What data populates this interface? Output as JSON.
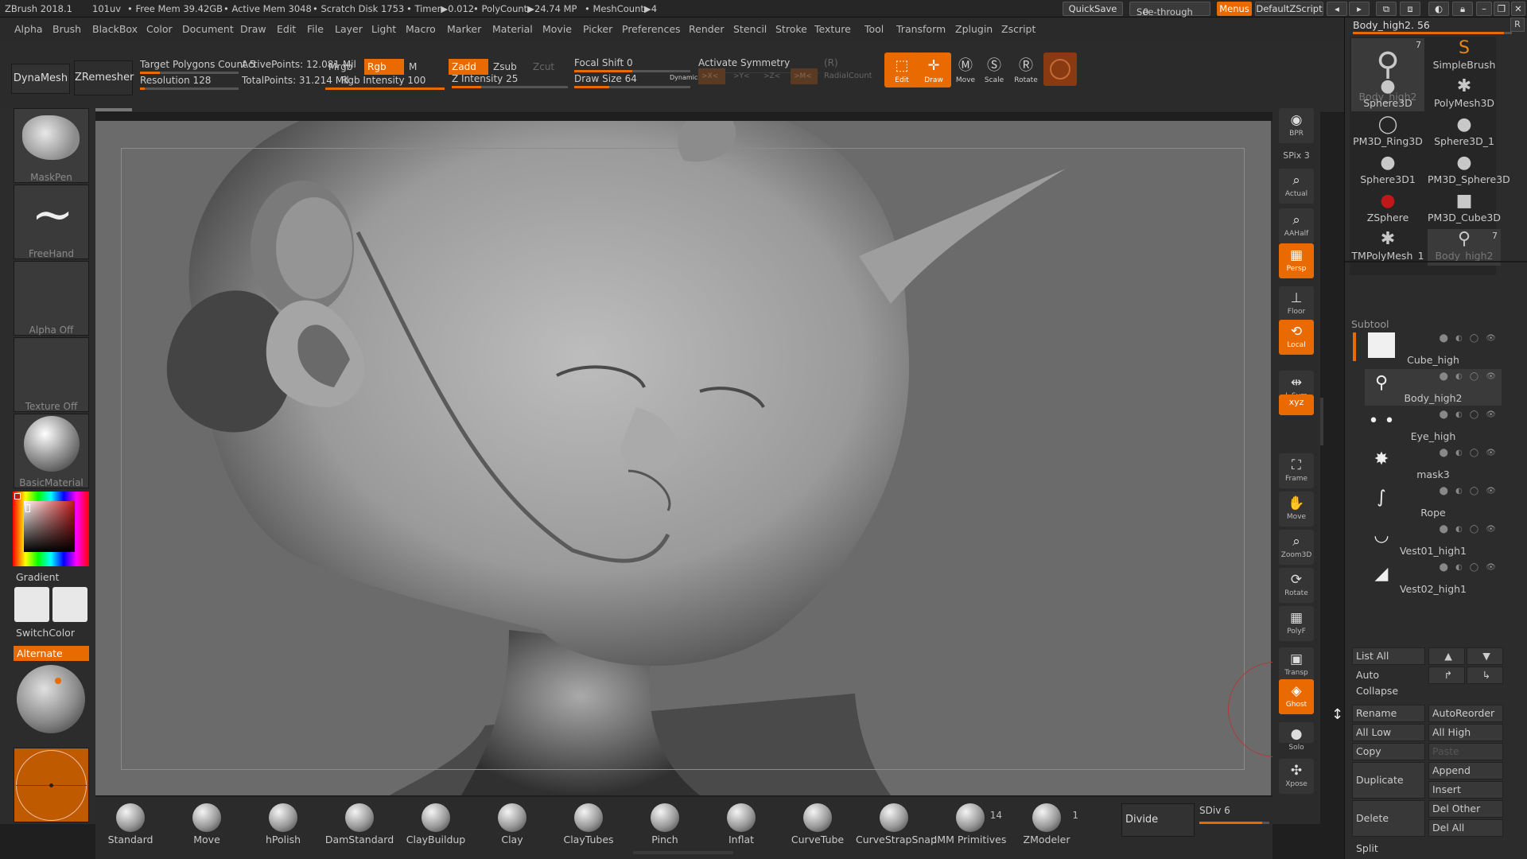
{
  "topbar": {
    "app": "ZBrush 2018.1",
    "uv": "101uv",
    "free_mem": "• Free Mem 39.42GB",
    "active_mem": "• Active Mem 3048",
    "scratch": "• Scratch Disk 1753",
    "timer": "• Timer▶0.012",
    "polycount": "• PolyCount▶24.74 MP",
    "meshcount": "• MeshCount▶4",
    "quicksave": "QuickSave",
    "seethrough": "See-through",
    "seethrough_val": "0",
    "menus": "Menus",
    "defaultzscript": "DefaultZScript"
  },
  "menu": [
    "Alpha",
    "Brush",
    "BlackBox",
    "Color",
    "Document",
    "Draw",
    "Edit",
    "File",
    "Layer",
    "Light",
    "Macro",
    "Marker",
    "Material",
    "Movie",
    "Picker",
    "Preferences",
    "Render",
    "Stencil",
    "Stroke",
    "Texture",
    "Tool",
    "Transform",
    "Zplugin",
    "Zscript"
  ],
  "shelf": {
    "dynamesh": "DynaMesh",
    "zremesher": "ZRemesher",
    "target_poly": "Target Polygons Count 5",
    "resolution": "Resolution 128",
    "active_points": "ActivePoints: 12.081 Mil",
    "total_points": "TotalPoints: 31.214 Mil",
    "mrgb": "Mrgb",
    "rgb": "Rgb",
    "m": "M",
    "rgb_intensity": "Rgb Intensity 100",
    "zadd": "Zadd",
    "zsub": "Zsub",
    "zcut": "Zcut",
    "z_intensity": "Z Intensity 25",
    "focal_shift": "Focal Shift 0",
    "draw_size": "Draw Size 64",
    "dynamic": "Dynamic",
    "activate_symmetry": "Activate Symmetry",
    "sym_r": "(R)",
    "sym_x": ">X<",
    "sym_y": ">Y<",
    "sym_z": ">Z<",
    "sym_m": ">M<",
    "radial": "RadialCount",
    "edit": "Edit",
    "draw": "Draw",
    "move": "Move",
    "scale": "Scale",
    "rotate": "Rotate"
  },
  "left": {
    "maskpen": "MaskPen",
    "freehand": "FreeHand",
    "alpha": "Alpha Off",
    "texture": "Texture Off",
    "material": "BasicMaterial",
    "gradient": "Gradient",
    "switchcolor": "SwitchColor",
    "alternate": "Alternate"
  },
  "rightstrip": [
    {
      "name": "bpr",
      "label": "BPR",
      "icon": "◉",
      "on": false
    },
    {
      "name": "spix",
      "label": "SPix 3",
      "icon": "",
      "on": false
    },
    {
      "name": "actual",
      "label": "Actual",
      "icon": "⌕",
      "on": false
    },
    {
      "name": "aahalf",
      "label": "AAHalf",
      "icon": "⌕",
      "on": false
    },
    {
      "name": "persp",
      "label": "Persp",
      "icon": "▦",
      "on": true
    },
    {
      "name": "floor",
      "label": "Floor",
      "icon": "⊥",
      "on": false
    },
    {
      "name": "local",
      "label": "Local",
      "icon": "⟲",
      "on": true
    },
    {
      "name": "lsym",
      "label": "L.Sym",
      "icon": "⇹",
      "on": false
    },
    {
      "name": "xyz",
      "label": "xyz",
      "icon": "⟳",
      "on": true
    },
    {
      "name": "frame",
      "label": "Frame",
      "icon": "⛶",
      "on": false
    },
    {
      "name": "move",
      "label": "Move",
      "icon": "✋",
      "on": false
    },
    {
      "name": "zoom3d",
      "label": "Zoom3D",
      "icon": "⌕",
      "on": false
    },
    {
      "name": "rotate",
      "label": "Rotate",
      "icon": "⟳",
      "on": false
    },
    {
      "name": "polyf",
      "label": "PolyF",
      "icon": "▦",
      "on": false
    },
    {
      "name": "transp",
      "label": "Transp",
      "icon": "▣",
      "on": false
    },
    {
      "name": "ghost",
      "label": "Ghost",
      "icon": "◈",
      "on": true
    },
    {
      "name": "solo",
      "label": "Solo",
      "icon": "●",
      "on": false
    },
    {
      "name": "xpose",
      "label": "Xpose",
      "icon": "✣",
      "on": false
    }
  ],
  "tool": {
    "title": "Body_high2. 56",
    "r": "R",
    "items": [
      {
        "label": "Body_high2",
        "icon": "⚲"
      },
      {
        "label": "SimpleBrush",
        "icon": "S"
      },
      {
        "label": "Sphere3D",
        "icon": "●"
      },
      {
        "label": "PolyMesh3D",
        "icon": "✱"
      },
      {
        "label": "PM3D_Ring3D",
        "icon": "◯"
      },
      {
        "label": "Sphere3D_1",
        "icon": "●"
      },
      {
        "label": "Sphere3D1",
        "icon": "●"
      },
      {
        "label": "PM3D_Sphere3D",
        "icon": "●"
      },
      {
        "label": "ZSphere",
        "icon": "●"
      },
      {
        "label": "PM3D_Cube3D",
        "icon": "■"
      },
      {
        "label": "TMPolyMesh_1",
        "icon": "✱"
      },
      {
        "label": "Body_high2",
        "icon": "⚲"
      }
    ],
    "count": "7"
  },
  "subtool": {
    "header": "Subtool",
    "items": [
      {
        "label": "Cube_high",
        "icon": "■"
      },
      {
        "label": "Body_high2",
        "icon": "⚲"
      },
      {
        "label": "Eye_high",
        "icon": "• •"
      },
      {
        "label": "mask3",
        "icon": "✸"
      },
      {
        "label": "Rope",
        "icon": "∫"
      },
      {
        "label": "Vest01_high1",
        "icon": "◡"
      },
      {
        "label": "Vest02_high1",
        "icon": "◢"
      }
    ],
    "list_all": "List All",
    "auto_collapse": "Auto Collapse",
    "rename": "Rename",
    "autoreorder": "AutoReorder",
    "all_low": "All Low",
    "all_high": "All High",
    "copy": "Copy",
    "paste": "Paste",
    "duplicate": "Duplicate",
    "append": "Append",
    "insert": "Insert",
    "delete": "Delete",
    "del_other": "Del Other",
    "del_all": "Del All",
    "split": "Split"
  },
  "brushes": [
    {
      "label": "Standard"
    },
    {
      "label": "Move"
    },
    {
      "label": "hPolish"
    },
    {
      "label": "DamStandard"
    },
    {
      "label": "ClayBuildup"
    },
    {
      "label": "Clay"
    },
    {
      "label": "ClayTubes"
    },
    {
      "label": "Pinch"
    },
    {
      "label": "Inflat"
    },
    {
      "label": "CurveTube"
    },
    {
      "label": "CurveStrapSnap"
    },
    {
      "label": "IMM Primitives",
      "count": "14"
    },
    {
      "label": "ZModeler",
      "count": "1"
    }
  ],
  "divide": "Divide",
  "sdiv": "SDiv 6",
  "sliders": {
    "target_poly": 0.2,
    "resolution": 0.05,
    "rgb_intensity": 1.0,
    "z_intensity": 0.25,
    "focal_shift": 0.5,
    "draw_size": 0.3,
    "sdiv": 0.9,
    "tool_scroll": 0.95
  },
  "colors": {
    "accent": "#e86a00",
    "canvas": "#6b6b6b"
  }
}
